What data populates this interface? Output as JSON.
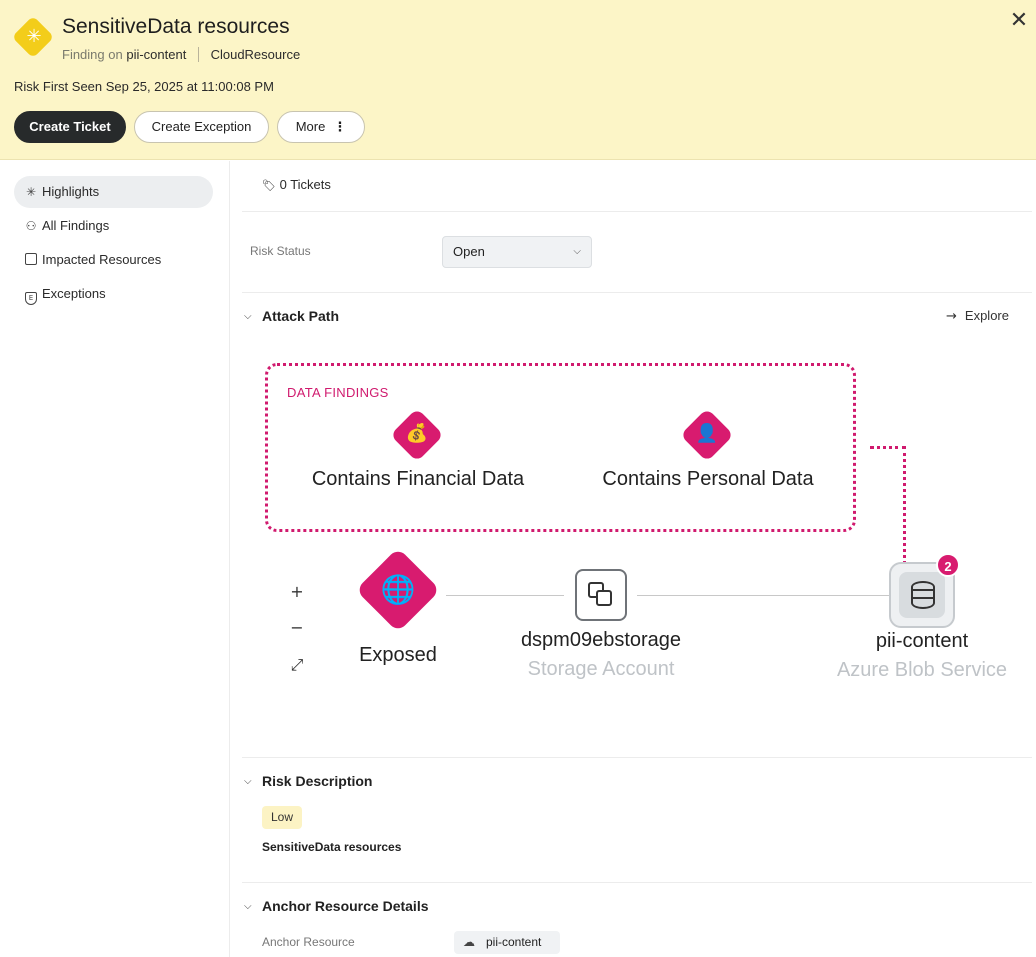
{
  "header": {
    "title": "SensitiveData resources",
    "finding_on_label": "Finding on",
    "finding_on_value": "pii-content",
    "resource_type": "CloudResource",
    "risk_first_seen": "Risk First Seen Sep 25, 2025 at 11:00:08 PM",
    "buttons": {
      "create_ticket": "Create Ticket",
      "create_exception": "Create Exception",
      "more": "More"
    },
    "colors": {
      "background": "#fcf5c7",
      "logo": "#f3cd1a"
    }
  },
  "sidebar": {
    "items": [
      {
        "label": "Highlights",
        "icon": "sparkle-icon",
        "active": true
      },
      {
        "label": "All Findings",
        "icon": "binoculars-icon",
        "active": false
      },
      {
        "label": "Impacted Resources",
        "icon": "resources-icon",
        "active": false
      },
      {
        "label": "Exceptions",
        "icon": "exception-shield-icon",
        "active": false
      }
    ]
  },
  "main": {
    "tickets": "0 Tickets",
    "risk_status": {
      "label": "Risk Status",
      "value": "Open"
    },
    "attack_path": {
      "title": "Attack Path",
      "explore": "Explore",
      "data_findings_label": "DATA FINDINGS",
      "findings": [
        {
          "label": "Contains Financial Data",
          "icon": "money-bag-lock-icon"
        },
        {
          "label": "Contains Personal Data",
          "icon": "person-lock-icon"
        }
      ],
      "nodes": [
        {
          "name": "Exposed",
          "type": "",
          "icon": "globe-icon"
        },
        {
          "name": "dspm09ebstorage",
          "type": "Storage Account",
          "icon": "storage-account-icon"
        },
        {
          "name": "pii-content",
          "type": "Azure Blob Service",
          "icon": "database-icon",
          "badge": "2"
        }
      ],
      "zoom": {
        "in": "+",
        "out": "−",
        "fit": "⤢"
      },
      "accent": "#d81b6f"
    },
    "risk_description": {
      "title": "Risk Description",
      "severity": "Low",
      "text": "SensitiveData resources"
    },
    "anchor_resource": {
      "title": "Anchor Resource Details",
      "label": "Anchor Resource",
      "value": "pii-content"
    }
  }
}
